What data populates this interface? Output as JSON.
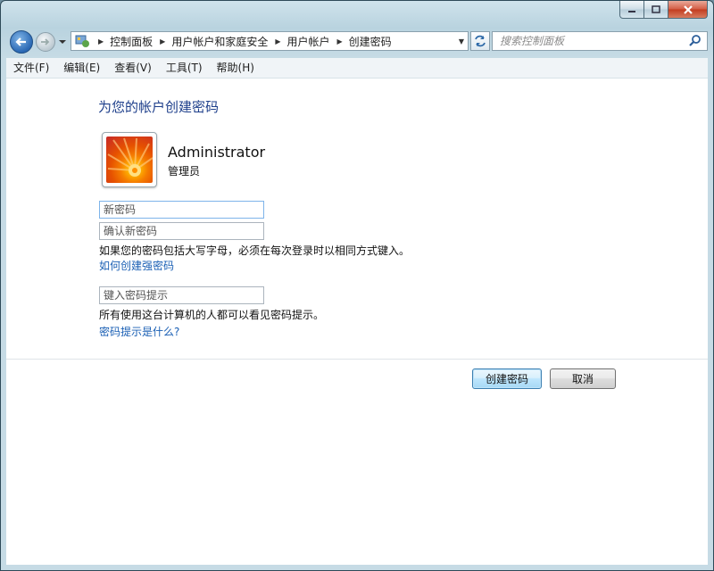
{
  "window": {
    "caption_buttons": [
      "minimize-icon",
      "maximize-icon",
      "close-icon"
    ]
  },
  "navigation": {
    "breadcrumb": [
      "控制面板",
      "用户帐户和家庭安全",
      "用户帐户",
      "创建密码"
    ],
    "search_placeholder": "搜索控制面板"
  },
  "menu": {
    "items": [
      "文件(F)",
      "编辑(E)",
      "查看(V)",
      "工具(T)",
      "帮助(H)"
    ]
  },
  "page": {
    "title": "为您的帐户创建密码",
    "user": {
      "name": "Administrator",
      "role": "管理员"
    },
    "fields": {
      "new_password_placeholder": "新密码",
      "confirm_password_placeholder": "确认新密码",
      "hint_placeholder": "键入密码提示"
    },
    "case_note": "如果您的密码包括大写字母，必须在每次登录时以相同方式键入。",
    "strong_password_link": "如何创建强密码",
    "hint_note": "所有使用这台计算机的人都可以看见密码提示。",
    "hint_link": "密码提示是什么?",
    "create_button": "创建密码",
    "cancel_button": "取消"
  },
  "colors": {
    "title_blue": "#1e3f8b",
    "link_blue": "#1a5fb4",
    "close_red": "#c23b1f"
  }
}
